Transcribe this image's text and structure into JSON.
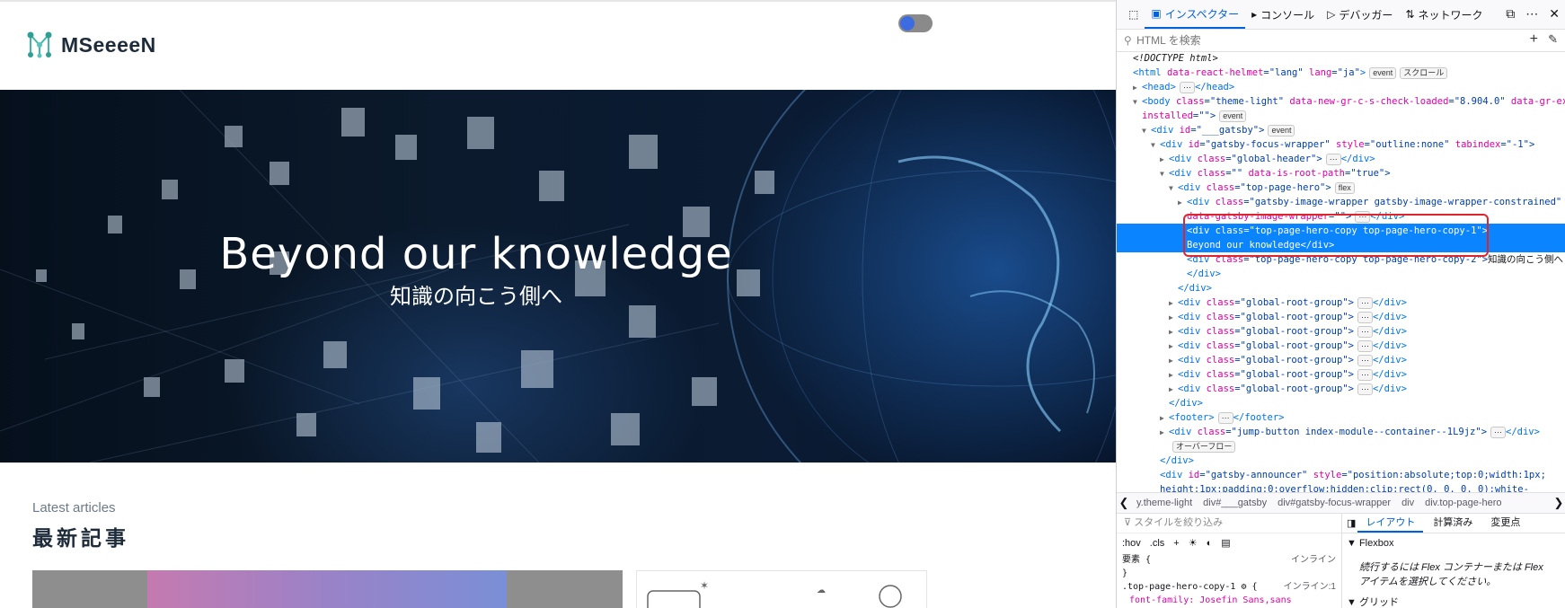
{
  "page": {
    "logo_text": "MSeeeeN",
    "hero_title": "Beyond our knowledge",
    "hero_subtitle": "知識の向こう側へ",
    "section_label_en": "Latest articles",
    "section_title_ja": "最新記事"
  },
  "devtools": {
    "tabs": [
      {
        "label": "インスペクター",
        "icon": "inspector-icon"
      },
      {
        "label": "コンソール",
        "icon": "console-icon"
      },
      {
        "label": "デバッガー",
        "icon": "debugger-icon"
      },
      {
        "label": "ネットワーク",
        "icon": "network-icon"
      }
    ],
    "search_placeholder": "HTML を検索",
    "tree": {
      "l1": "<!DOCTYPE html>",
      "l2_tag_open": "<html ",
      "l2_attr1": "data-react-helmet",
      "l2_eq1": "=",
      "l2_val1": "\"lang\"",
      "l2_attr2": " lang",
      "l2_val2": "=\"ja\"",
      "l2_close": ">",
      "badge_event": "event",
      "badge_scroll": "スクロール",
      "badge_flex": "flex",
      "badge_overflow": "オーバーフロー",
      "l3": "<head>",
      "l3b": "</head>",
      "l4_open": "<body ",
      "l4_class_attr": "class",
      "l4_class_val": "=\"theme-light\"",
      "l4_attr2": " data-new-gr-c-s-check-loaded",
      "l4_val2": "=\"8.904.0\"",
      "l4_attr3": " data-gr-ext-",
      "l5": "installed",
      "l5_val": "=\"\">",
      "l6_open": "<div ",
      "l6_attr": "id",
      "l6_val": "=\"___gatsby\">",
      "l7_open": "<div ",
      "l7_attr": "id",
      "l7_val": "=\"gatsby-focus-wrapper\"",
      "l7_attr2": " style",
      "l7_val2": "=\"outline:none\"",
      "l7_attr3": " tabindex",
      "l7_val3": "=\"-1\">",
      "l8_open": "<div ",
      "l8_attr": "class",
      "l8_val": "=\"global-header\">",
      "l8_close": "</div>",
      "l9_open": "<div ",
      "l9_attr": "class",
      "l9_val": "=\"\"",
      "l9_attr2": " data-is-root-path",
      "l9_val2": "=\"true\">",
      "l10_open": "<div ",
      "l10_attr": "class",
      "l10_val": "=\"top-page-hero\">",
      "l11_open": "<div ",
      "l11_attr": "class",
      "l11_val": "=\"gatsby-image-wrapper gatsby-image-wrapper-constrained\"",
      "l12_attr": "data-gatsby-image-wrapper",
      "l12_val": "=\"\">",
      "l12_close": "</div>",
      "l13_open": "<div ",
      "l13_attr": "class",
      "l13_val": "=\"top-page-hero-copy top-page-hero-copy-1\">",
      "l14_text": "Beyond our knowledge",
      "l14_close": "</div>",
      "l15_open": "<div ",
      "l15_attr": "class",
      "l15_val": "=\"top-page-hero-copy top-page-hero-copy-2\">",
      "l15_text": "知識の向こう側へ",
      "l16": "</div>",
      "l17": "</div>",
      "root_group_open": "<div ",
      "root_group_attr": "class",
      "root_group_val": "=\"global-root-group\">",
      "root_group_close": "</div>",
      "l25": "</div>",
      "l26_open": "<footer>",
      "l26_close": "</footer>",
      "l27_open": "<div ",
      "l27_attr": "class",
      "l27_val": "=\"jump-button index-module--container--1L9jz\">",
      "l27_close": "</div>",
      "l29": "</div>",
      "l30_open": "<div ",
      "l30_attr": "id",
      "l30_val": "=\"gatsby-announcer\"",
      "l30_attr2": " style",
      "l30_val2": "=\"position:absolute;top:0;width:1px;",
      "l31": "height:1px;padding:0;overflow:hidden;clip:rect(0, 0, 0, 0);white-"
    },
    "breadcrumbs": [
      "y.theme-light",
      "div#___gatsby",
      "div#gatsby-focus-wrapper",
      "div",
      "div.top-page-hero"
    ],
    "styles": {
      "filter_placeholder": "スタイルを絞り込み",
      "hov": ":hov",
      "cls": ".cls",
      "element_rule": "要素 {",
      "element_src": "インライン",
      "element_close": "}",
      "rule2": ".top-page-hero-copy-1",
      "rule2_src": "インライン:1",
      "rule3": "font-family: Josefin Sans,sans"
    },
    "layout": {
      "tabs": [
        "レイアウト",
        "計算済み",
        "変更点"
      ],
      "flexbox_title": "Flexbox",
      "flexbox_msg": "続行するには Flex コンテナーまたは Flex アイテムを選択してください。",
      "grid_title": "グリッド"
    }
  },
  "colors": {
    "accent": "#0061e0",
    "selected_row": "#0a84ff",
    "highlight_box": "#e0242c",
    "logo_green": "#3fb6a8"
  }
}
